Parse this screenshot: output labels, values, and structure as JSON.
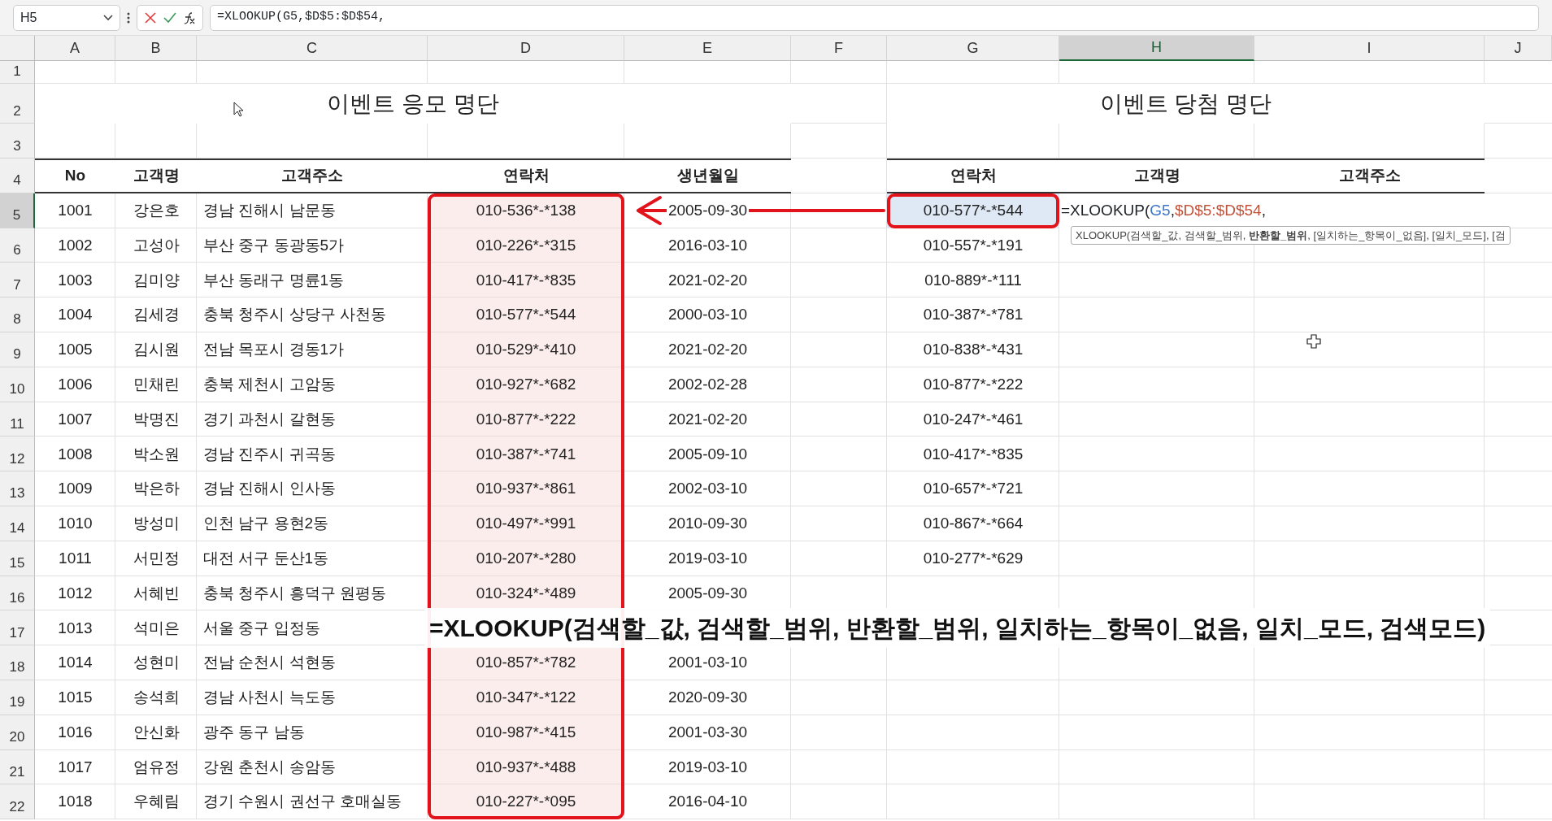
{
  "name_box": "H5",
  "formula_bar": "=XLOOKUP(G5,$D$5:$D$54,",
  "column_headers": [
    {
      "label": "A",
      "selected": false
    },
    {
      "label": "B",
      "selected": false
    },
    {
      "label": "C",
      "selected": false
    },
    {
      "label": "D",
      "selected": false
    },
    {
      "label": "E",
      "selected": false
    },
    {
      "label": "F",
      "selected": false
    },
    {
      "label": "G",
      "selected": false
    },
    {
      "label": "H",
      "selected": true
    },
    {
      "label": "I",
      "selected": false
    },
    {
      "label": "J",
      "selected": false
    }
  ],
  "row_headers": [
    {
      "label": "1",
      "selected": false
    },
    {
      "label": "2",
      "selected": false
    },
    {
      "label": "3",
      "selected": false
    },
    {
      "label": "4",
      "selected": false
    },
    {
      "label": "5",
      "selected": true
    },
    {
      "label": "6",
      "selected": false
    },
    {
      "label": "7",
      "selected": false
    },
    {
      "label": "8",
      "selected": false
    },
    {
      "label": "9",
      "selected": false
    },
    {
      "label": "10",
      "selected": false
    },
    {
      "label": "11",
      "selected": false
    },
    {
      "label": "12",
      "selected": false
    },
    {
      "label": "13",
      "selected": false
    },
    {
      "label": "14",
      "selected": false
    },
    {
      "label": "15",
      "selected": false
    },
    {
      "label": "16",
      "selected": false
    },
    {
      "label": "17",
      "selected": false
    },
    {
      "label": "18",
      "selected": false
    },
    {
      "label": "19",
      "selected": false
    },
    {
      "label": "20",
      "selected": false
    },
    {
      "label": "21",
      "selected": false
    },
    {
      "label": "22",
      "selected": false
    }
  ],
  "entry_table": {
    "title": "이벤트 응모 명단",
    "columns": [
      "No",
      "고객명",
      "고객주소",
      "연락처",
      "생년월일"
    ],
    "rows": [
      [
        "1001",
        "강은호",
        "경남 진해시 남문동",
        "010-536*-*138",
        "2005-09-30"
      ],
      [
        "1002",
        "고성아",
        "부산 중구 동광동5가",
        "010-226*-*315",
        "2016-03-10"
      ],
      [
        "1003",
        "김미양",
        "부산 동래구 명륜1동",
        "010-417*-*835",
        "2021-02-20"
      ],
      [
        "1004",
        "김세경",
        "충북 청주시 상당구 사천동",
        "010-577*-*544",
        "2000-03-10"
      ],
      [
        "1005",
        "김시원",
        "전남 목포시 경동1가",
        "010-529*-*410",
        "2021-02-20"
      ],
      [
        "1006",
        "민채린",
        "충북 제천시 고암동",
        "010-927*-*682",
        "2002-02-28"
      ],
      [
        "1007",
        "박명진",
        "경기 과천시 갈현동",
        "010-877*-*222",
        "2021-02-20"
      ],
      [
        "1008",
        "박소원",
        "경남 진주시 귀곡동",
        "010-387*-*741",
        "2005-09-10"
      ],
      [
        "1009",
        "박은하",
        "경남 진해시 인사동",
        "010-937*-*861",
        "2002-03-10"
      ],
      [
        "1010",
        "방성미",
        "인천 남구 용현2동",
        "010-497*-*991",
        "2010-09-30"
      ],
      [
        "1011",
        "서민정",
        "대전 서구 둔산1동",
        "010-207*-*280",
        "2019-03-10"
      ],
      [
        "1012",
        "서혜빈",
        "충북 청주시 흥덕구 원평동",
        "010-324*-*489",
        "2005-09-30"
      ],
      [
        "1013",
        "석미은",
        "서울 중구 입정동"
      ],
      [
        "1014",
        "성현미",
        "전남 순천시 석현동",
        "010-857*-*782",
        "2001-03-10"
      ],
      [
        "1015",
        "송석희",
        "경남 사천시 늑도동",
        "010-347*-*122",
        "2020-09-30"
      ],
      [
        "1016",
        "안신화",
        "광주 동구 남동",
        "010-987*-*415",
        "2001-03-30"
      ],
      [
        "1017",
        "엄유정",
        "강원 춘천시 송암동",
        "010-937*-*488",
        "2019-03-10"
      ],
      [
        "1018",
        "우혜림",
        "경기 수원시 권선구 호매실동",
        "010-227*-*095",
        "2016-04-10"
      ]
    ]
  },
  "winner_table": {
    "title": "이벤트 당첨 명단",
    "columns": [
      "연락처",
      "고객명",
      "고객주소"
    ],
    "rows": [
      {
        "contact": "010-577*-*544",
        "referenced": true
      },
      {
        "contact": "010-557*-*191",
        "referenced": false
      },
      {
        "contact": "010-889*-*111",
        "referenced": false
      },
      {
        "contact": "010-387*-*781",
        "referenced": false
      },
      {
        "contact": "010-838*-*431",
        "referenced": false
      },
      {
        "contact": "010-877*-*222",
        "referenced": false
      },
      {
        "contact": "010-247*-*461",
        "referenced": false
      },
      {
        "contact": "010-417*-*835",
        "referenced": false
      },
      {
        "contact": "010-657*-*721",
        "referenced": false
      },
      {
        "contact": "010-867*-*664",
        "referenced": false
      },
      {
        "contact": "010-277*-*629",
        "referenced": false
      }
    ]
  },
  "active_cell": {
    "parts": [
      {
        "text": "=XLOOKUP(",
        "kind": "plain"
      },
      {
        "text": "G5",
        "kind": "ref_blue"
      },
      {
        "text": ",",
        "kind": "plain"
      },
      {
        "text": "$D$5:$D$54",
        "kind": "ref_red"
      },
      {
        "text": ",",
        "kind": "plain"
      }
    ],
    "tooltip": "XLOOKUP(검색할_값, 검색할_범위, **반환할_범위**, [일치하는_항목이_없음], [일치_모드], [검"
  },
  "caption": "=XLOOKUP(검색할_값, 검색할_범위, 반환할_범위, 일치하는_항목이_없음, 일치_모드, 검색모드)"
}
